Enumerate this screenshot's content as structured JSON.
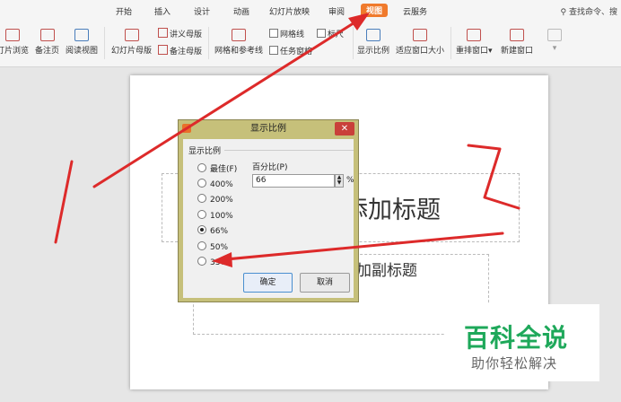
{
  "tabs": [
    "开始",
    "插入",
    "设计",
    "动画",
    "幻灯片放映",
    "审阅",
    "视图",
    "云服务"
  ],
  "active_tab": "视图",
  "search_label": "查找命令、搜",
  "toolbar": {
    "slide_browse": "灯片浏览",
    "notes_page": "备注页",
    "reading_view": "阅读视图",
    "slide_master": "幻灯片母版",
    "handout_master": "讲义母版",
    "notes_master": "备注母版",
    "grid_guides": "网格和参考线",
    "gridlines": "网格线",
    "ruler": "标尺",
    "task_pane": "任务窗格",
    "zoom": "显示比例",
    "fit_window": "适应窗口大小",
    "arrange_windows": "重排窗口",
    "new_window": "新建窗口"
  },
  "slide": {
    "title_placeholder": "单击此处添加标题",
    "title_visible": "添加标题",
    "subtitle_visible": "加副标题"
  },
  "dialog": {
    "title": "显示比例",
    "close": "✕",
    "group_label": "显示比例",
    "options": [
      "最佳(F)",
      "400%",
      "200%",
      "100%",
      "66%",
      "50%",
      "33%"
    ],
    "selected": "66%",
    "percent_label": "百分比(P)",
    "percent_value": "66",
    "percent_unit": "%",
    "ok": "确定",
    "cancel": "取消"
  },
  "watermark": {
    "title": "百科全说",
    "subtitle": "助你轻松解决"
  },
  "colors": {
    "accent": "#f07a2c",
    "arrow": "#dd2a2a",
    "dialog_frame": "#c6c07a",
    "watermark_green": "#1ea85a"
  }
}
